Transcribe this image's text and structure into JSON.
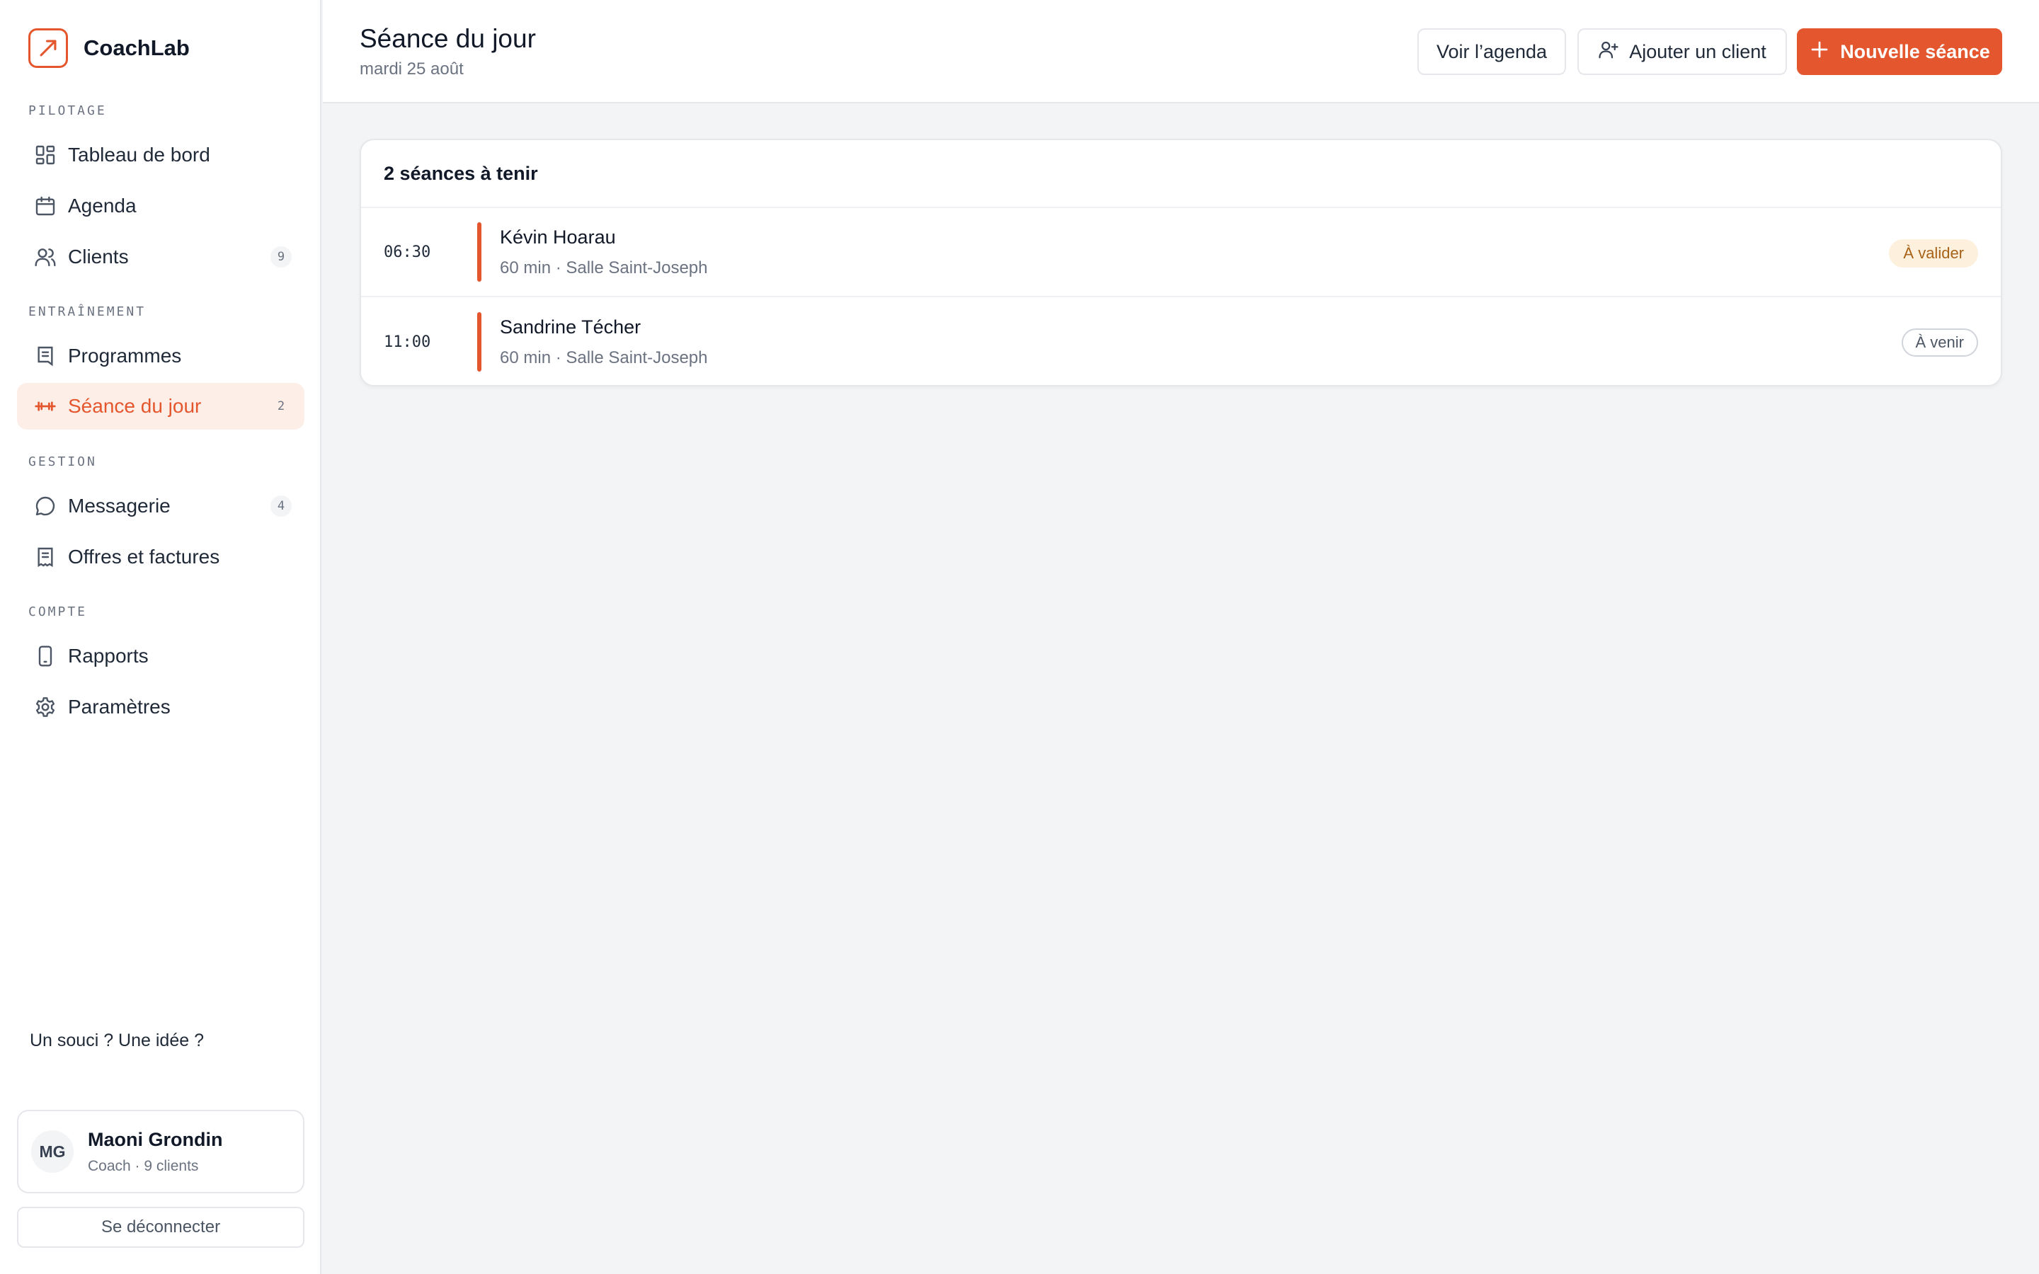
{
  "brand": {
    "name": "CoachLab",
    "logo_icon": "trend-arrow-icon",
    "accent": "#e4572e"
  },
  "sidebar": {
    "sections": [
      {
        "label": "PILOTAGE",
        "items": [
          {
            "label": "Tableau de bord",
            "icon": "dashboard-grid-icon"
          },
          {
            "label": "Agenda",
            "icon": "calendar-icon"
          },
          {
            "label": "Clients",
            "icon": "users-icon",
            "count": "9"
          }
        ]
      },
      {
        "label": "ENTRAÎNEMENT",
        "items": [
          {
            "label": "Programmes",
            "icon": "document-icon"
          },
          {
            "label": "Séance du jour",
            "icon": "dumbbell-icon",
            "count": "2",
            "active": true
          }
        ]
      },
      {
        "label": "GESTION",
        "items": [
          {
            "label": "Messagerie",
            "icon": "chat-bubble-icon",
            "count": "4"
          },
          {
            "label": "Offres et factures",
            "icon": "receipt-icon"
          }
        ]
      },
      {
        "label": "COMPTE",
        "items": [
          {
            "label": "Rapports",
            "icon": "phone-icon"
          },
          {
            "label": "Paramètres",
            "icon": "gear-icon"
          }
        ]
      }
    ],
    "feedback": "Un souci ? Une idée ?",
    "user": {
      "initials": "MG",
      "name": "Maoni Grondin",
      "meta": "Coach · 9 clients"
    },
    "logout": "Se déconnecter"
  },
  "header": {
    "title": "Séance du jour",
    "date": "mardi 25 août",
    "buttons": {
      "agenda": "Voir l’agenda",
      "add_client": "Ajouter un client",
      "new_session": "Nouvelle séance"
    }
  },
  "sessions": {
    "title": "2 séances à tenir",
    "rows": [
      {
        "time": "06:30",
        "name": "Kévin Hoarau",
        "meta": "60 min · Salle Saint-Joseph",
        "status": "À valider"
      },
      {
        "time": "11:00",
        "name": "Sandrine Técher",
        "meta": "60 min · Salle Saint-Joseph",
        "status": "À venir"
      }
    ]
  }
}
